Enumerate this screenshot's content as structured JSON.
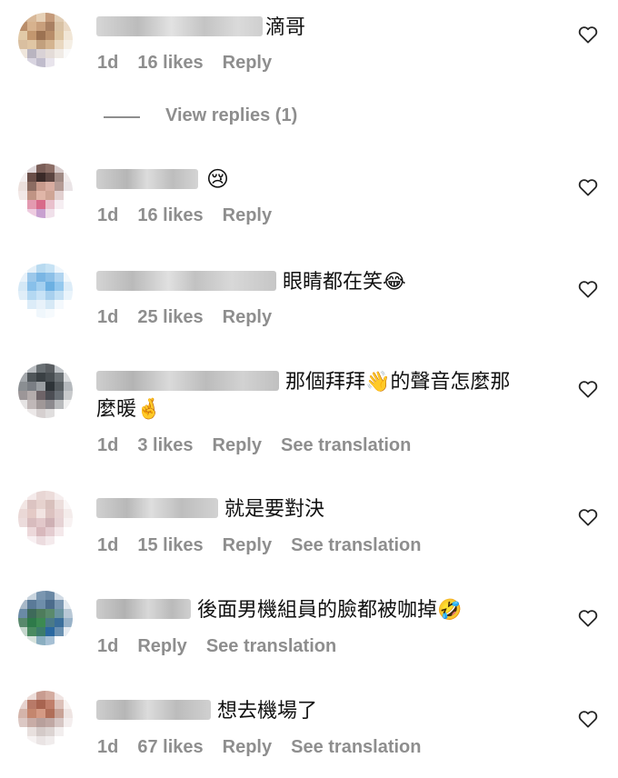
{
  "comments": [
    {
      "text": "滴哥",
      "time": "1d",
      "likes": "16 likes",
      "reply": "Reply",
      "translate": ""
    },
    {
      "text": "😢",
      "time": "1d",
      "likes": "16 likes",
      "reply": "Reply",
      "translate": ""
    },
    {
      "text": "眼睛都在笑😂",
      "time": "1d",
      "likes": "25 likes",
      "reply": "Reply",
      "translate": ""
    },
    {
      "text_line1": "那個拜拜👋的聲音怎麼那",
      "text_line2": "麼暖🤞",
      "time": "1d",
      "likes": "3 likes",
      "reply": "Reply",
      "translate": "See translation"
    },
    {
      "text": "就是要對決",
      "time": "1d",
      "likes": "15 likes",
      "reply": "Reply",
      "translate": "See translation"
    },
    {
      "text": "後面男機組員的臉都被咖掉🤣",
      "time": "1d",
      "likes": "",
      "reply": "Reply",
      "translate": "See translation"
    },
    {
      "text": "想去機場了",
      "time": "1d",
      "likes": "67 likes",
      "reply": "Reply",
      "translate": "See translation"
    }
  ],
  "view_replies": "View replies (1)",
  "icons": {
    "like": "heart-outline-icon"
  },
  "colors": {
    "meta": "#8e8e8e",
    "text": "#111111"
  }
}
